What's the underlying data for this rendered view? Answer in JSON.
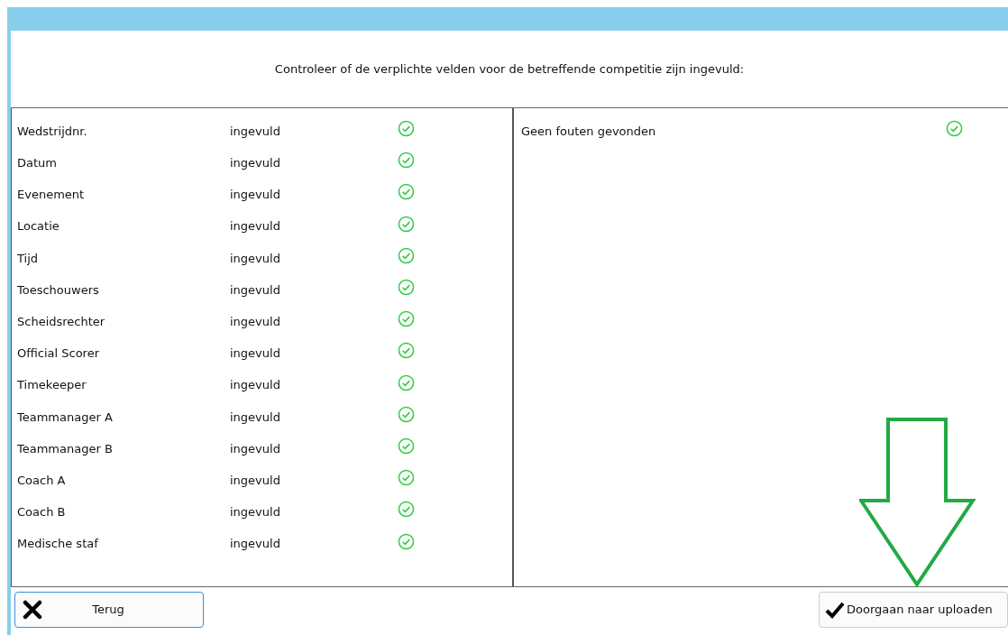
{
  "heading": "Controleer of de verplichte velden voor de betreffende competitie zijn ingevuld:",
  "fields": [
    {
      "label": "Wedstrijdnr.",
      "status": "ingevuld",
      "ok": true
    },
    {
      "label": "Datum",
      "status": "ingevuld",
      "ok": true
    },
    {
      "label": "Evenement",
      "status": "ingevuld",
      "ok": true
    },
    {
      "label": "Locatie",
      "status": "ingevuld",
      "ok": true
    },
    {
      "label": "Tijd",
      "status": "ingevuld",
      "ok": true
    },
    {
      "label": "Toeschouwers",
      "status": "ingevuld",
      "ok": true
    },
    {
      "label": "Scheidsrechter",
      "status": "ingevuld",
      "ok": true
    },
    {
      "label": "Official Scorer",
      "status": "ingevuld",
      "ok": true
    },
    {
      "label": "Timekeeper",
      "status": "ingevuld",
      "ok": true
    },
    {
      "label": "Teammanager A",
      "status": "ingevuld",
      "ok": true
    },
    {
      "label": "Teammanager B",
      "status": "ingevuld",
      "ok": true
    },
    {
      "label": "Coach A",
      "status": "ingevuld",
      "ok": true
    },
    {
      "label": "Coach B",
      "status": "ingevuld",
      "ok": true
    },
    {
      "label": "Medische staf",
      "status": "ingevuld",
      "ok": true
    }
  ],
  "errors": [
    {
      "text": "Geen fouten gevonden",
      "ok": true
    }
  ],
  "back_button": "Terug",
  "continue_button": "Doorgaan naar uploaden"
}
